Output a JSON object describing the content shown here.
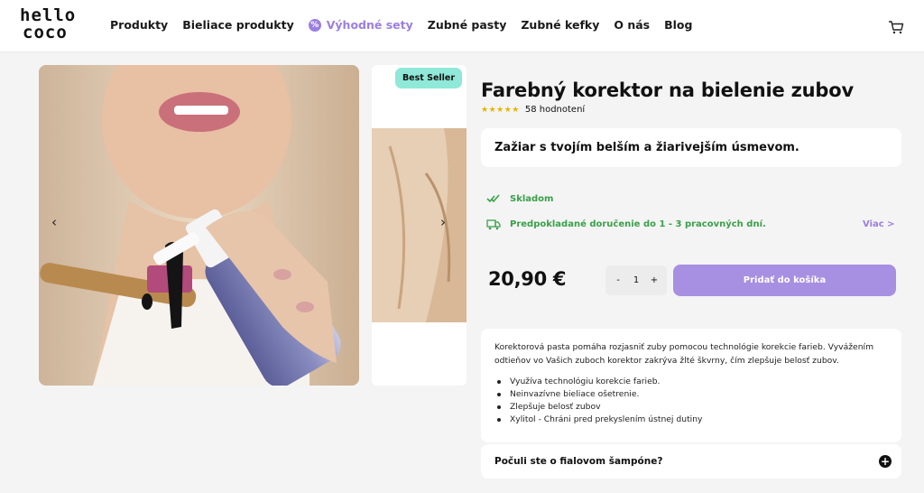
{
  "header": {
    "logo": {
      "line1": "hello",
      "line2": "coco"
    },
    "nav": [
      {
        "label": "Produkty"
      },
      {
        "label": "Bieliace produkty"
      },
      {
        "label": "Výhodné sety",
        "promo_icon": "%"
      },
      {
        "label": "Zubné pasty"
      },
      {
        "label": "Zubné kefky"
      },
      {
        "label": "O nás"
      },
      {
        "label": "Blog"
      }
    ],
    "cart_icon": "cart-icon"
  },
  "gallery": {
    "badge": "Best Seller",
    "prev_arrow": "‹",
    "next_arrow": "›"
  },
  "product": {
    "title": "Farebný korektor na bielenie zubov",
    "stars": "★★★★★",
    "rating_count": "58 hodnotení",
    "tagline": "Zažiar s tvojím belším a žiarivejším úsmevom.",
    "stock": "Skladom",
    "delivery": "Predpokladané doručenie do 1 - 3 pracovných dní.",
    "more_link": "Viac >",
    "price": "20,90 €",
    "qty_minus": "-",
    "qty_value": "1",
    "qty_plus": "+",
    "add_to_cart": "Pridať do košíka",
    "description": "Korektorová pasta pomáha rozjasniť zuby pomocou technológie korekcie farieb. Vyvážením odtieňov vo Vašich zuboch korektor zakrýva žlté škvrny, čím zlepšuje belosť zubov.",
    "bullets": [
      "Využíva technológiu korekcie farieb.",
      "Neinvazívne bieliace ošetrenie.",
      "Zlepšuje belosť zubov",
      "Xylitol - Chráni pred prekyslením ústnej dutiny"
    ],
    "faq_question": "Počuli ste o fialovom šampóne?",
    "faq_toggle": "+"
  },
  "colors": {
    "accent_purple": "#a78fe2",
    "promo_purple": "#9b7ee0",
    "badge_mint": "#8fe8d8",
    "success_green": "#3aa04a",
    "star_gold": "#e5b400"
  }
}
